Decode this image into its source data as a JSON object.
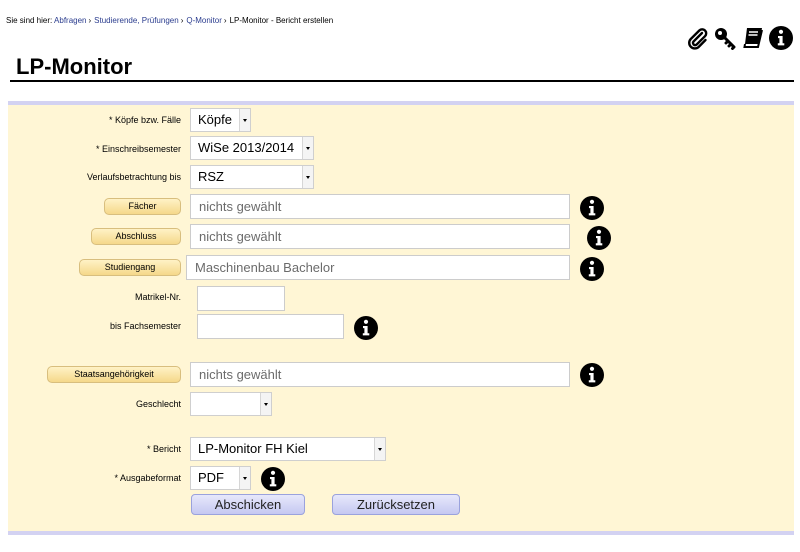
{
  "breadcrumb": {
    "prefix": "Sie sind hier:",
    "links": [
      "Abfragen",
      "Studierende, Prüfungen",
      "Q-Monitor"
    ],
    "current": "LP-Monitor - Bericht erstellen"
  },
  "toolbar": {
    "icons": [
      "paperclip-icon",
      "key-icon",
      "book-icon",
      "info-icon"
    ]
  },
  "page": {
    "title": "LP-Monitor"
  },
  "form": {
    "koepfe": {
      "label": "* Köpfe bzw. Fälle",
      "value": "Köpfe"
    },
    "semester": {
      "label": "* Einschreibsemester",
      "value": "WiSe 2013/2014"
    },
    "verlauf": {
      "label": "Verlaufsbetrachtung bis",
      "value": "RSZ"
    },
    "faecher": {
      "button": "Fächer",
      "value": "nichts gewählt"
    },
    "abschluss": {
      "button": "Abschluss",
      "value": "nichts gewählt"
    },
    "studiengang": {
      "button": "Studiengang",
      "value": "Maschinenbau Bachelor"
    },
    "matrikel": {
      "label": "Matrikel-Nr.",
      "value": ""
    },
    "fachsemester": {
      "label": "bis Fachsemester",
      "value": ""
    },
    "staat": {
      "button": "Staatsangehörigkeit",
      "value": "nichts gewählt"
    },
    "geschlecht": {
      "label": "Geschlecht",
      "value": ""
    },
    "bericht": {
      "label": "* Bericht",
      "value": "LP-Monitor FH Kiel"
    },
    "format": {
      "label": "* Ausgabeformat",
      "value": "PDF"
    },
    "submit_label": "Abschicken",
    "reset_label": "Zurücksetzen"
  },
  "colors": {
    "panel_bg": "#fff6d5",
    "panel_border": "#d3d2f2",
    "link": "#2a3c8e",
    "button_bg": "#c5c8f1",
    "pill_bg": "#f5d88a"
  }
}
